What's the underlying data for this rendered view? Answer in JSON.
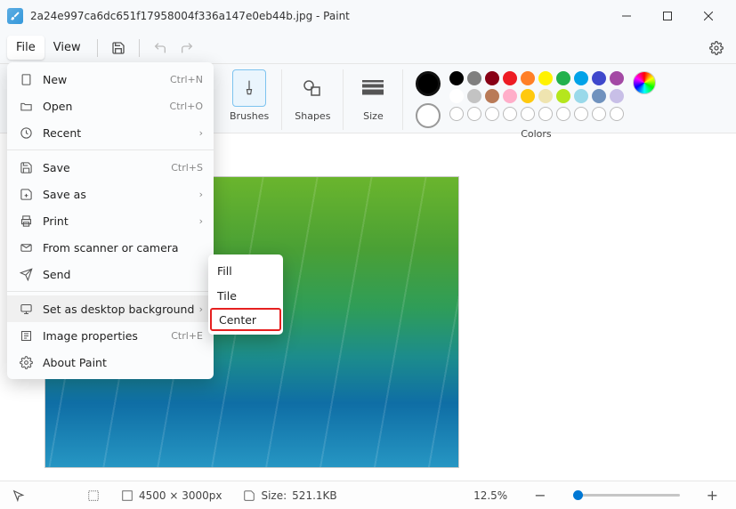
{
  "title": "2a24e997ca6dc651f17958004f336a147e0eb44b.jpg - Paint",
  "menubar": {
    "file": "File",
    "view": "View"
  },
  "ribbon": {
    "brushes": "Brushes",
    "shapes": "Shapes",
    "size": "Size",
    "colors": "Colors"
  },
  "palette_colors": [
    [
      "#000000",
      "#7f7f7f",
      "#880015",
      "#ed1c24",
      "#ff7f27",
      "#fff200",
      "#22b14c",
      "#00a2e8",
      "#3f48cc",
      "#a349a4"
    ],
    [
      "#ffffff",
      "#c3c3c3",
      "#b97a57",
      "#ffaec9",
      "#ffc90e",
      "#efe4b0",
      "#b5e61d",
      "#99d9ea",
      "#7092be",
      "#c8bfe7"
    ]
  ],
  "file_menu": [
    {
      "icon": "new",
      "label": "New",
      "shortcut": "Ctrl+N"
    },
    {
      "icon": "open",
      "label": "Open",
      "shortcut": "Ctrl+O"
    },
    {
      "icon": "recent",
      "label": "Recent",
      "chev": true
    },
    {
      "icon": "save",
      "label": "Save",
      "shortcut": "Ctrl+S"
    },
    {
      "icon": "saveas",
      "label": "Save as",
      "chev": true
    },
    {
      "icon": "print",
      "label": "Print",
      "chev": true
    },
    {
      "icon": "scanner",
      "label": "From scanner or camera"
    },
    {
      "icon": "send",
      "label": "Send"
    },
    {
      "icon": "desktop",
      "label": "Set as desktop background",
      "chev": true,
      "hover": true
    },
    {
      "icon": "props",
      "label": "Image properties",
      "shortcut": "Ctrl+E"
    },
    {
      "icon": "about",
      "label": "About Paint"
    }
  ],
  "submenu": {
    "fill": "Fill",
    "tile": "Tile",
    "center": "Center"
  },
  "status": {
    "dimensions": "4500 × 3000px",
    "size_label": "Size:",
    "size_value": "521.1KB",
    "zoom": "12.5%"
  }
}
